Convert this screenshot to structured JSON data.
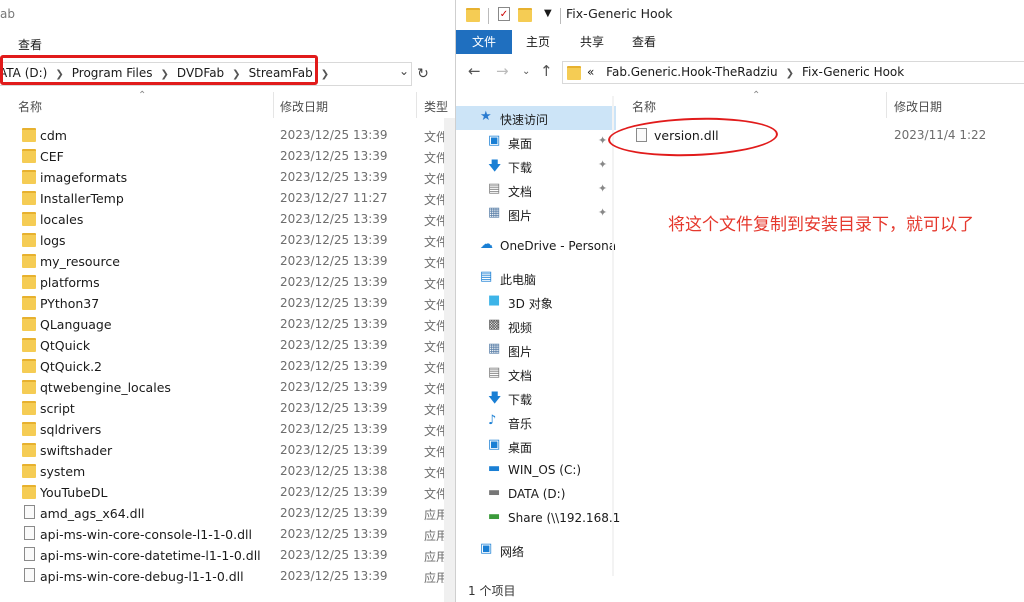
{
  "left": {
    "title": "ab",
    "ribbon_tab": "查看",
    "address": [
      "ATA (D:)",
      "Program Files",
      "DVDFab",
      "StreamFab"
    ],
    "columns": {
      "name": "名称",
      "modified": "修改日期",
      "type": "类型"
    },
    "rows": [
      {
        "name": "cdm",
        "date": "2023/12/25 13:39",
        "type": "文件夹",
        "kind": "folder"
      },
      {
        "name": "CEF",
        "date": "2023/12/25 13:39",
        "type": "文件夹",
        "kind": "folder"
      },
      {
        "name": "imageformats",
        "date": "2023/12/25 13:39",
        "type": "文件夹",
        "kind": "folder"
      },
      {
        "name": "InstallerTemp",
        "date": "2023/12/27 11:27",
        "type": "文件夹",
        "kind": "folder"
      },
      {
        "name": "locales",
        "date": "2023/12/25 13:39",
        "type": "文件夹",
        "kind": "folder"
      },
      {
        "name": "logs",
        "date": "2023/12/25 13:39",
        "type": "文件夹",
        "kind": "folder"
      },
      {
        "name": "my_resource",
        "date": "2023/12/25 13:39",
        "type": "文件夹",
        "kind": "folder"
      },
      {
        "name": "platforms",
        "date": "2023/12/25 13:39",
        "type": "文件夹",
        "kind": "folder"
      },
      {
        "name": "PYthon37",
        "date": "2023/12/25 13:39",
        "type": "文件夹",
        "kind": "folder"
      },
      {
        "name": "QLanguage",
        "date": "2023/12/25 13:39",
        "type": "文件夹",
        "kind": "folder"
      },
      {
        "name": "QtQuick",
        "date": "2023/12/25 13:39",
        "type": "文件夹",
        "kind": "folder"
      },
      {
        "name": "QtQuick.2",
        "date": "2023/12/25 13:39",
        "type": "文件夹",
        "kind": "folder"
      },
      {
        "name": "qtwebengine_locales",
        "date": "2023/12/25 13:39",
        "type": "文件夹",
        "kind": "folder"
      },
      {
        "name": "script",
        "date": "2023/12/25 13:39",
        "type": "文件夹",
        "kind": "folder"
      },
      {
        "name": "sqldrivers",
        "date": "2023/12/25 13:39",
        "type": "文件夹",
        "kind": "folder"
      },
      {
        "name": "swiftshader",
        "date": "2023/12/25 13:39",
        "type": "文件夹",
        "kind": "folder"
      },
      {
        "name": "system",
        "date": "2023/12/25 13:38",
        "type": "文件夹",
        "kind": "folder"
      },
      {
        "name": "YouTubeDL",
        "date": "2023/12/25 13:39",
        "type": "文件夹",
        "kind": "folder"
      },
      {
        "name": "amd_ags_x64.dll",
        "date": "2023/12/25 13:39",
        "type": "应用程",
        "kind": "dll"
      },
      {
        "name": "api-ms-win-core-console-l1-1-0.dll",
        "date": "2023/12/25 13:39",
        "type": "应用程",
        "kind": "dll"
      },
      {
        "name": "api-ms-win-core-datetime-l1-1-0.dll",
        "date": "2023/12/25 13:39",
        "type": "应用程",
        "kind": "dll"
      },
      {
        "name": "api-ms-win-core-debug-l1-1-0.dll",
        "date": "2023/12/25 13:39",
        "type": "应用程",
        "kind": "dll"
      }
    ]
  },
  "right": {
    "window_title": "Fix-Generic Hook",
    "tabs": [
      "文件",
      "主页",
      "共享",
      "查看"
    ],
    "address": [
      "Fab.Generic.Hook-TheRadziu",
      "Fix-Generic Hook"
    ],
    "address_prefix": "«",
    "nav": [
      {
        "label": "快速访问",
        "icon": "star-icon",
        "pinned": false,
        "selected": true,
        "indent": 24
      },
      {
        "label": "桌面",
        "icon": "desktop-icon",
        "pinned": true,
        "indent": 32
      },
      {
        "label": "下载",
        "icon": "download-icon",
        "pinned": true,
        "indent": 32
      },
      {
        "label": "文档",
        "icon": "document-icon",
        "pinned": true,
        "indent": 32
      },
      {
        "label": "图片",
        "icon": "picture-icon",
        "pinned": true,
        "indent": 32
      },
      {
        "label": "OneDrive - Persona",
        "icon": "cloud-icon",
        "pinned": false,
        "indent": 24,
        "gap": true
      },
      {
        "label": "此电脑",
        "icon": "computer-icon",
        "pinned": false,
        "indent": 24,
        "gap": true
      },
      {
        "label": "3D 对象",
        "icon": "cube-icon",
        "pinned": false,
        "indent": 32
      },
      {
        "label": "视频",
        "icon": "video-icon",
        "pinned": false,
        "indent": 32
      },
      {
        "label": "图片",
        "icon": "picture-icon",
        "pinned": false,
        "indent": 32
      },
      {
        "label": "文档",
        "icon": "document-icon",
        "pinned": false,
        "indent": 32
      },
      {
        "label": "下载",
        "icon": "download-icon",
        "pinned": false,
        "indent": 32
      },
      {
        "label": "音乐",
        "icon": "music-icon",
        "pinned": false,
        "indent": 32
      },
      {
        "label": "桌面",
        "icon": "desktop-icon",
        "pinned": false,
        "indent": 32
      },
      {
        "label": "WIN_OS (C:)",
        "icon": "drive-c-icon",
        "pinned": false,
        "indent": 32
      },
      {
        "label": "DATA (D:)",
        "icon": "drive-icon",
        "pinned": false,
        "indent": 32
      },
      {
        "label": "Share (\\\\192.168.1",
        "icon": "network-drive-icon",
        "pinned": false,
        "indent": 32
      },
      {
        "label": "网络",
        "icon": "network-icon",
        "pinned": false,
        "indent": 24,
        "gap": true
      }
    ],
    "columns": {
      "name": "名称",
      "modified": "修改日期"
    },
    "file": {
      "name": "version.dll",
      "date": "2023/11/4 1:22"
    },
    "note": "将这个文件复制到安装目录下，就可以了",
    "status": "1 个项目",
    "colors": {
      "accent": "#1f6fbf",
      "annotation": "#e11b1b",
      "note_text": "#e5382d",
      "folder": "#f5cc54"
    }
  }
}
